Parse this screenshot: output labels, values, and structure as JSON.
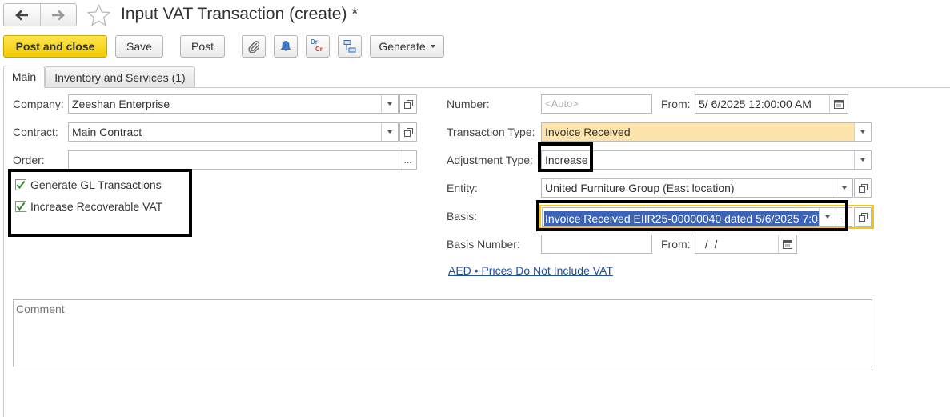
{
  "window": {
    "title": "Input VAT Transaction (create) *",
    "back_icon": "arrow-left-icon",
    "forward_icon": "arrow-right-icon",
    "favorite_icon": "star-icon"
  },
  "toolbar": {
    "post_and_close": "Post and close",
    "save": "Save",
    "post": "Post",
    "generate": "Generate",
    "attach_icon": "paperclip-icon",
    "reminder_icon": "bell-icon",
    "dr_cr_icon": "dr-cr-icon",
    "dr": "Dr",
    "cr": "Cr",
    "structure_icon": "structure-icon"
  },
  "tabs": [
    {
      "label": "Main",
      "active": true
    },
    {
      "label": "Inventory and Services (1)",
      "active": false
    }
  ],
  "form": {
    "company": {
      "label": "Company:",
      "value": "Zeeshan Enterprise"
    },
    "contract": {
      "label": "Contract:",
      "value": "Main Contract"
    },
    "order": {
      "label": "Order:",
      "value": "",
      "button": "..."
    },
    "generate_gl": {
      "label": "Generate GL Transactions",
      "checked": true
    },
    "increase_vat": {
      "label": "Increase Recoverable VAT",
      "checked": true
    },
    "number": {
      "label": "Number:",
      "placeholder": "<Auto>"
    },
    "from_date": {
      "label": "From:",
      "value": "5/ 6/2025 12:00:00 AM"
    },
    "transaction_type": {
      "label": "Transaction Type:",
      "value": "Invoice Received"
    },
    "adjustment_type": {
      "label": "Adjustment Type:",
      "value": "Increase"
    },
    "entity": {
      "label": "Entity:",
      "value": "United Furniture Group (East location)"
    },
    "basis": {
      "label": "Basis:",
      "value": "Invoice Received EIIR25-00000040 dated 5/6/2025 7:0",
      "clear": "…"
    },
    "basis_number": {
      "label": "Basis Number:",
      "value": ""
    },
    "basis_from": {
      "label": "From:",
      "value": "  /  /"
    },
    "currency_link": "AED • Prices Do Not Include VAT",
    "comment": {
      "placeholder": "Comment"
    }
  },
  "colors": {
    "primary_button": "#f5cf0c",
    "highlight_field": "#fde4ad",
    "selection": "#3c63b8",
    "link": "#1f4fa0",
    "checkmark": "#2e8b2e",
    "annotation_box": "#000000",
    "focus_border": "#f5c518"
  }
}
